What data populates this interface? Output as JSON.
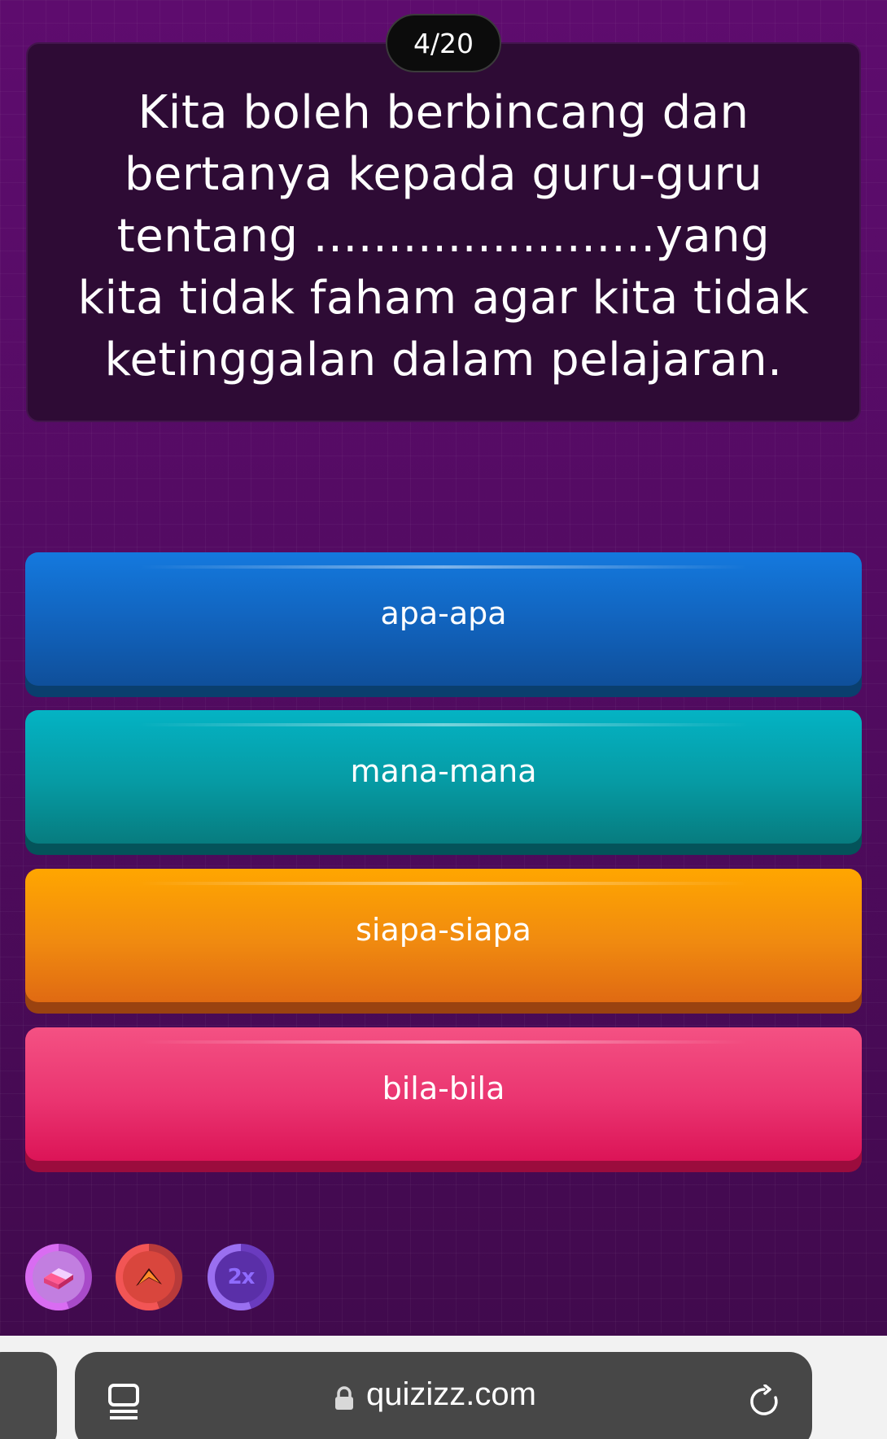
{
  "counter": {
    "label": "4/20"
  },
  "question": {
    "text": "Kita boleh berbincang dan bertanya kepada guru-guru tentang .......................yang kita tidak faham agar kita tidak ketinggalan dalam pelajaran."
  },
  "options": [
    {
      "label": "apa-apa",
      "color": "#1479de"
    },
    {
      "label": "mana-mana",
      "color": "#04b3c4"
    },
    {
      "label": "siapa-siapa",
      "color": "#ffa600"
    },
    {
      "label": "bila-bila",
      "color": "#f45183"
    }
  ],
  "powerups": [
    {
      "icon": "eraser-icon"
    },
    {
      "icon": "streak-arrow-icon"
    },
    {
      "icon": "double-points-icon",
      "label": "2x"
    }
  ],
  "browser": {
    "url": "quizizz.com",
    "icons": [
      "tabs-icon",
      "lock-icon",
      "reload-icon"
    ]
  },
  "colors": {
    "background": "#5e0c6e",
    "card": "#2e0b35"
  }
}
